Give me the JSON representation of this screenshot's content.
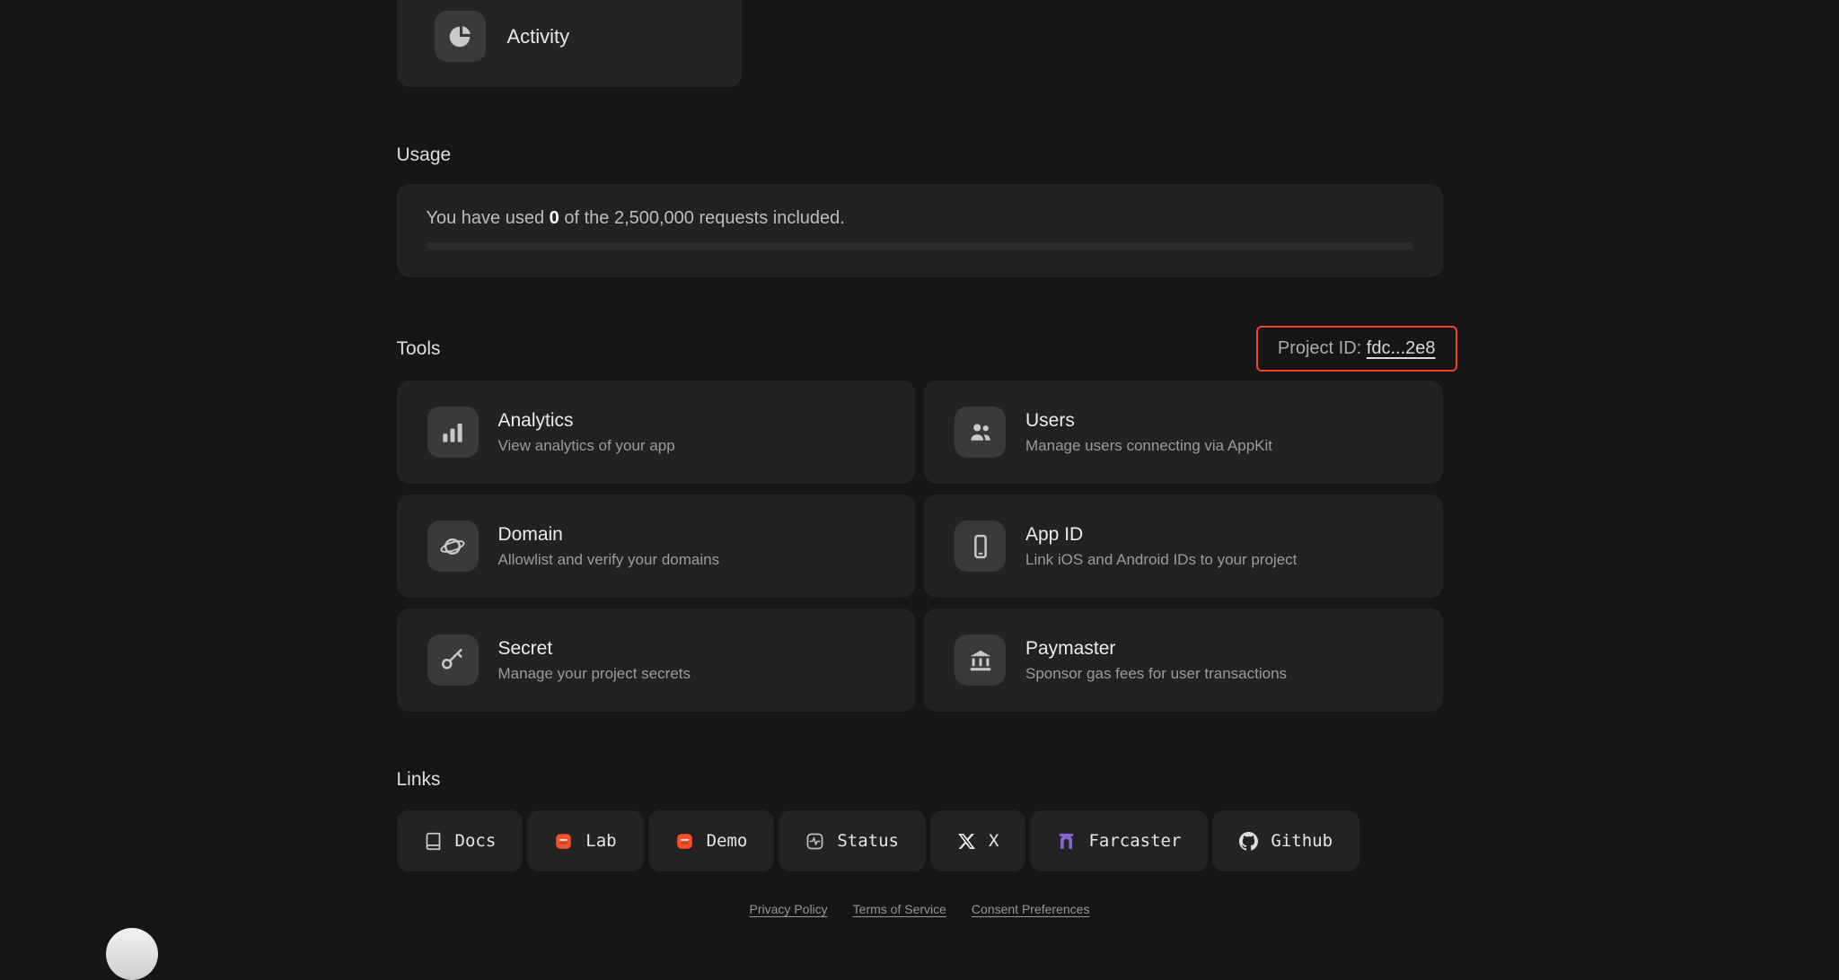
{
  "activity": {
    "label": "Activity",
    "icon": "pie-chart-icon"
  },
  "usage": {
    "heading": "Usage",
    "line_prefix": "You have used ",
    "used_count": "0",
    "line_suffix": " of the 2,500,000 requests included.",
    "progress_percent": "0"
  },
  "tools": {
    "heading": "Tools",
    "project_id_label": "Project ID: ",
    "project_id_value": "fdc...2e8",
    "cards": [
      {
        "title": "Analytics",
        "subtitle": "View analytics of your app",
        "icon": "bar-chart-icon"
      },
      {
        "title": "Users",
        "subtitle": "Manage users connecting via AppKit",
        "icon": "users-icon"
      },
      {
        "title": "Domain",
        "subtitle": "Allowlist and verify your domains",
        "icon": "planet-icon"
      },
      {
        "title": "App ID",
        "subtitle": "Link iOS and Android IDs to your project",
        "icon": "mobile-icon"
      },
      {
        "title": "Secret",
        "subtitle": "Manage your project secrets",
        "icon": "key-icon"
      },
      {
        "title": "Paymaster",
        "subtitle": "Sponsor gas fees for user transactions",
        "icon": "bank-icon"
      }
    ]
  },
  "links": {
    "heading": "Links",
    "items": [
      {
        "label": "Docs",
        "icon": "book-icon"
      },
      {
        "label": "Lab",
        "icon": "lab-logo-icon"
      },
      {
        "label": "Demo",
        "icon": "demo-logo-icon"
      },
      {
        "label": "Status",
        "icon": "status-icon"
      },
      {
        "label": "X",
        "icon": "x-logo-icon"
      },
      {
        "label": "Farcaster",
        "icon": "farcaster-icon"
      },
      {
        "label": "Github",
        "icon": "github-icon"
      }
    ]
  },
  "footer": {
    "links": [
      "Privacy Policy",
      "Terms of Service",
      "Consent Preferences"
    ]
  },
  "colors": {
    "highlight_border": "#ef4429",
    "accent_orange": "#f4502c",
    "farcaster_purple": "#8a63d2",
    "background": "#161616",
    "card": "#222222"
  }
}
